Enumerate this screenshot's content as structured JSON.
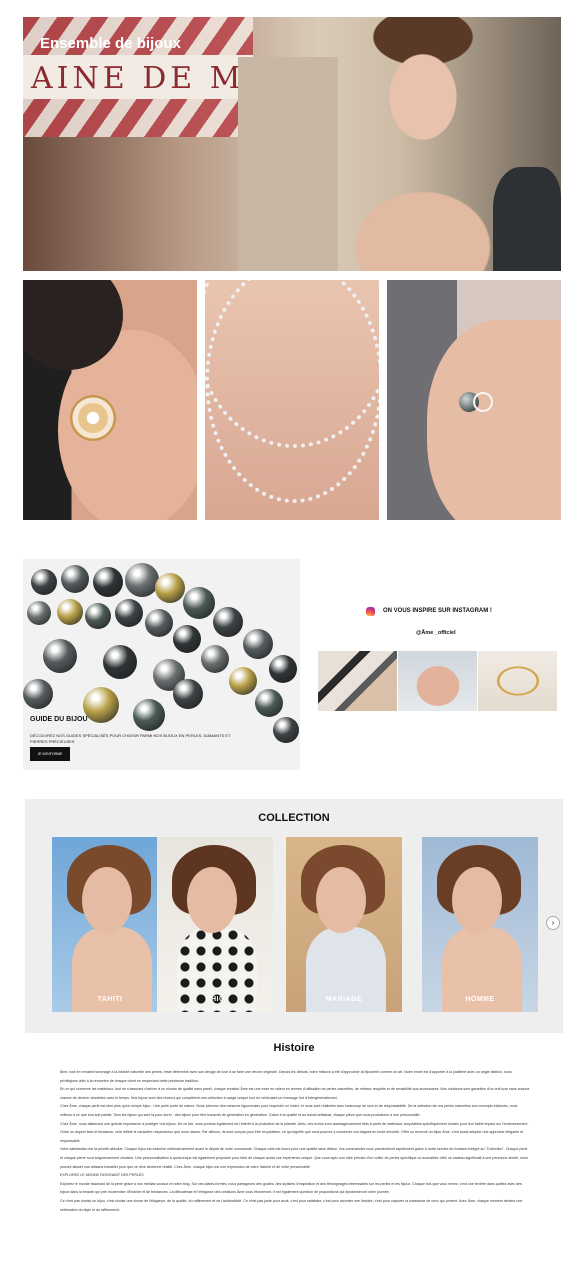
{
  "hero": {
    "title": "Ensemble de bijoux",
    "sign_text": "AINE DE M"
  },
  "guide": {
    "title": "GUIDE DU BIJOU",
    "text": "DÉCOUVREZ NOS GUIDES SPÉCIALISÉS POUR CHOISIR PARMI NOS BIJOUX EN PERLES, DIAMANTS ET PIERRES PRÉCIEUSES",
    "button_label": "JE M'INFORME"
  },
  "instagram": {
    "icon": "instagram-icon",
    "heading": "ON VOUS INSPIRE SUR INSTAGRAM !",
    "handle": "@Âme _officiel"
  },
  "collection": {
    "title": "COLLECTION",
    "cards": [
      {
        "label": "TAHITI"
      },
      {
        "label": "CHIC"
      },
      {
        "label": "MARIAGE"
      },
      {
        "label": "HOMME"
      }
    ],
    "next_icon": "chevron-right-icon",
    "next_glyph": "›"
  },
  "histoire": {
    "title": "Histoire",
    "paragraphs": [
      "Âme, tout en rendant hommage à la beauté naturelle des perles, reste déterminé avec son design de luxe à se faire une œuvre originale. Depuis les débuts, notre mission a été d'approcher la bijouterie comme un art. Notre envie est d'apporter à la joaillerie avec un angle distinct, nous privilégions aller à la rencontre de chaque client en respectant cette précieuse tradition.",
      "En ce qui concerne les matériaux, tout en s'assurant d'arriver à un niveau de qualité sans pareil, chaque création Âme est une mise en valeur en termes d'utilisation de perles naturelles, de métaux recyclés et de sensibilité aux accessoires. Nos créations sont garanties d'un vrai luxe sans aucune chance de devenir obsolètes avec le temps. Nos bijoux sont des rêveurs qui complètent une collection à usage unique tout en véhiculant un message fort d'intergénérationnel.",
      "Chez Âme, chaque perle est bien plus qu'un simple bijou : Une perle porte de nature. Nous prenons des mesures rigoureuses pour respecter un intact, et nous sont réalisées avec beaucoup de soin et de responsabilité. De la sélection de nos perles naturelles aux concepts élaborés, nous veillons à ce que tout soit parfait. Tous les bijoux qui sont là pour durer : des bijoux pour être transmis de génération en génération. Grâce à la qualité et au travail artisanal, chaque pièce que nous produisons a une personnalité.",
      "Chez Âme, nous attachons une grande importance à protéger nos bijoux. De ce fait, nous portons également de l'intérêt à la protection de la planète. Ainsi, ces écrins sont avantageusement faits à partir de matériaux recyclables spécifiquement choisis pour leur faible impact sur l'environnement. Outre un aspect face et tendance, cela reflète le caractère respectueux que nous visons. Par ailleurs, ils sont conçus pour être recyclables, ce qui signifie que vous pourrez y conserver vos bagues en toute sécurité. Offrir ou recevoir un bijou Âme, c'est aussi adopter une approche élégante et responsable.",
      "Votre satisfaction est la priorité absolue. Chaque bijou est examiné méticuleusement avant le départ de votre commande. Chaque colis est fourni pour une qualité sans défaut. Vos commandes vous parviendront rapidement grâce à notre service de livraison intégré au \"Collection\". Chaque perle et chaque pierre sont soigneusement choisies. Une personnalisation à quelconque est également proposée pour faire de chaque achat une expérience unique. Que vous ayez une idée précise d'un collier de perles spécifique ou souhaitiez offrir un cadeau significatif à une personne aimée, nous pouvez laisser nos artisans travailler pour que ce rêve devienne réalité. Chez Âme, chaque bijou est une expression de votre histoire et de votre personnalité.",
      "EXPLOREZ LE MONDE FASCINANT DES PERLES",
      "Explorez le monde fascinant de la perle grâce à nos médias sociaux et notre blog. Sur ces plates-formes, nous partageons des guides, des stylistes d'inspiration et des témoignages intéressants sur les perles et les bijoux. Chaque fois que vous venez, c'est une fenêtre dans quittez avec des bijoux dans la beauté qui prie moderniser d'histoire et de tendances. La délicatesse et l'élégance des créations Âme vous étonneront. Il est également question de propositions qui dynamiseront votre journée.",
      "Ce n'est pas choisir un bijou, c'est choisir une chose de l'élégance, de la qualité, du raffinement et de l'authenticité. Ce n'est pas juste pour avoir, c'est pour satisfaire, c'est pour raconter une histoire, c'est pour capturer la substance de ceux qui portent. Avec Âme, chaque moment devient une célébration du style et du raffinement."
    ]
  },
  "colors": {
    "accent_dark": "#111111",
    "collection_bg": "#eeeeee",
    "card_label": "#ffffff"
  }
}
